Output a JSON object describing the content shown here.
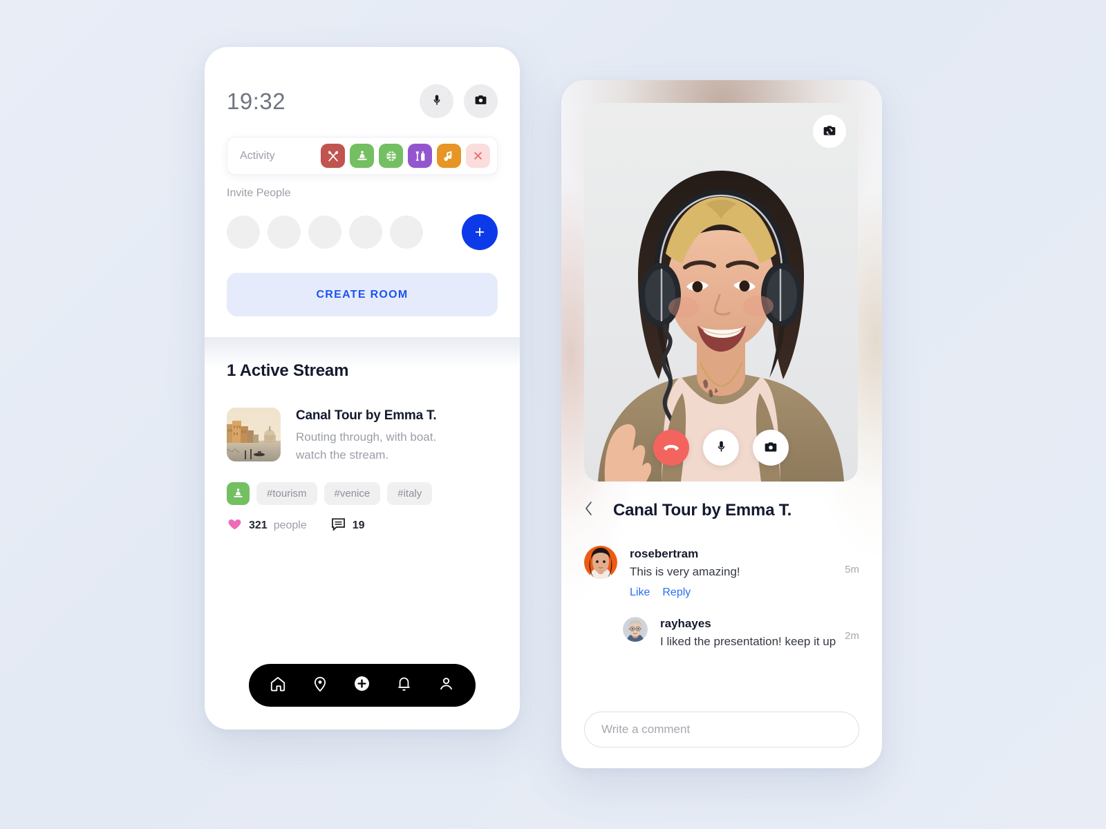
{
  "theme": {
    "background": "#e7ecf5",
    "accent_blue": "#0d3ae8",
    "link_blue": "#2a6ef0",
    "create_room_bg": "#e6ebfc",
    "create_room_text": "#1a53f0",
    "heart_pink": "#ef6bb8",
    "end_call_red": "#f4645f",
    "nav_black": "#000000",
    "text_dark": "#141a2e",
    "text_muted": "#9a9ea6"
  },
  "left_phone": {
    "status": {
      "time": "19:32",
      "mic_icon": "microphone-icon",
      "camera_icon": "camera-icon"
    },
    "activity": {
      "label": "Activity",
      "options": [
        {
          "name": "food",
          "icon": "fork-spoon-icon",
          "color": "#c1544f",
          "glyph": "✕"
        },
        {
          "name": "yoga",
          "icon": "meditation-icon",
          "color": "#73bf62",
          "glyph": "♒"
        },
        {
          "name": "sports",
          "icon": "basketball-icon",
          "color": "#73bf62",
          "glyph": "⚽"
        },
        {
          "name": "drinks",
          "icon": "bottle-glass-icon",
          "color": "#9356cf",
          "glyph": "☃"
        },
        {
          "name": "music",
          "icon": "music-note-icon",
          "color": "#e79524",
          "glyph": "♪"
        },
        {
          "name": "clear",
          "icon": "close-icon",
          "color": "#fadddc",
          "glyph": "✕"
        }
      ]
    },
    "invite": {
      "label": "Invite People",
      "slot_count": 5,
      "add_label": "+"
    },
    "create_room_label": "CREATE ROOM",
    "streams": {
      "heading": "1 Active Stream",
      "item": {
        "thumbnail": "venice-canal-photo",
        "title": "Canal Tour by Emma T.",
        "description_line1": "Routing through, with boat.",
        "description_line2": "watch the stream.",
        "category_icon": "meditation-icon",
        "tags": [
          "#tourism",
          "#venice",
          "#italy"
        ],
        "likes_count": "321",
        "likes_unit": "people",
        "comments_count": "19"
      }
    },
    "nav": [
      {
        "name": "home",
        "icon": "home-icon"
      },
      {
        "name": "explore",
        "icon": "location-pin-icon"
      },
      {
        "name": "create",
        "icon": "plus-circle-icon"
      },
      {
        "name": "notifications",
        "icon": "bell-icon"
      },
      {
        "name": "profile",
        "icon": "person-icon"
      }
    ]
  },
  "right_phone": {
    "video": {
      "subject": "woman-with-headphones-video-call",
      "switch_camera_icon": "camera-switch-icon",
      "controls": [
        {
          "name": "end-call",
          "icon": "hang-up-icon",
          "color": "#f4645f"
        },
        {
          "name": "mute",
          "icon": "microphone-icon",
          "color": "#ffffff"
        },
        {
          "name": "snapshot",
          "icon": "camera-icon",
          "color": "#ffffff"
        }
      ]
    },
    "detail": {
      "back_icon": "chevron-left-icon",
      "title": "Canal Tour by Emma T."
    },
    "comments": [
      {
        "avatar": "woman-orange-background-avatar",
        "username": "rosebertram",
        "text": "This is very amazing!",
        "time": "5m",
        "actions": [
          "Like",
          "Reply"
        ],
        "is_reply": false
      },
      {
        "avatar": "older-man-glasses-avatar",
        "username": "rayhayes",
        "text": "I liked the presentation! keep it up",
        "time": "2m",
        "actions": [],
        "is_reply": true
      }
    ],
    "comment_input_placeholder": "Write a comment",
    "comment_input_value": ""
  }
}
